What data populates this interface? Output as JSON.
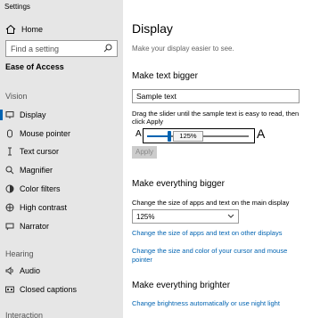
{
  "window": {
    "title": "Settings"
  },
  "sidebar": {
    "home_label": "Home",
    "search_placeholder": "Find a setting",
    "section_title": "Ease of Access",
    "groups": [
      {
        "label": "Vision"
      },
      {
        "label": "Hearing"
      },
      {
        "label": "Interaction"
      }
    ],
    "vision_items": [
      {
        "label": "Display",
        "icon": "display-icon",
        "active": true
      },
      {
        "label": "Mouse pointer",
        "icon": "mouse-pointer-icon"
      },
      {
        "label": "Text cursor",
        "icon": "text-cursor-icon"
      },
      {
        "label": "Magnifier",
        "icon": "magnifier-icon"
      },
      {
        "label": "Color filters",
        "icon": "color-filters-icon"
      },
      {
        "label": "High contrast",
        "icon": "high-contrast-icon"
      },
      {
        "label": "Narrator",
        "icon": "narrator-icon"
      }
    ],
    "hearing_items": [
      {
        "label": "Audio",
        "icon": "audio-icon"
      },
      {
        "label": "Closed captions",
        "icon": "closed-captions-icon"
      }
    ]
  },
  "main": {
    "title": "Display",
    "subtitle": "Make your display easier to see.",
    "text_bigger": {
      "heading": "Make text bigger",
      "sample_text": "Sample text",
      "help": "Drag the slider until the sample text is easy to read, then click Apply",
      "a_small": "A",
      "a_large": "A",
      "slider_value_label": "125%",
      "slider_fraction": 0.25,
      "apply_label": "Apply"
    },
    "everything_bigger": {
      "heading": "Make everything bigger",
      "dropdown_label": "Change the size of apps and text on the main display",
      "dropdown_value": "125%",
      "link_other_displays": "Change the size of apps and text on other displays",
      "link_cursor": "Change the size and color of your cursor and mouse pointer"
    },
    "everything_brighter": {
      "heading": "Make everything brighter",
      "link_brightness": "Change brightness automatically or use night light"
    }
  },
  "colors": {
    "accent": "#0063b1",
    "sidebar_bg": "#e6e6e6"
  }
}
